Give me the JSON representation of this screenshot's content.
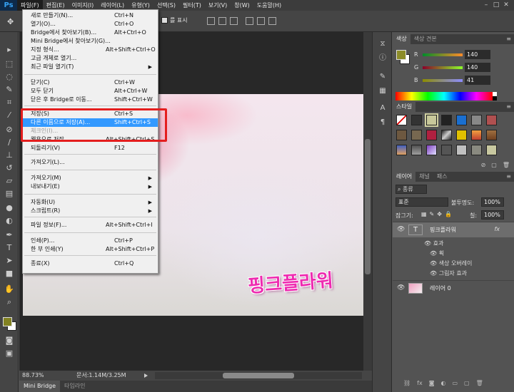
{
  "menubar": {
    "logo": "Ps",
    "items": [
      "파일(F)",
      "편집(E)",
      "이미지(I)",
      "레이어(L)",
      "유형(Y)",
      "선택(S)",
      "필터(T)",
      "보기(V)",
      "창(W)",
      "도움말(H)"
    ],
    "window_controls": [
      "–",
      "□",
      "✕"
    ]
  },
  "optionsbar": {
    "show_transform_label": "를 표시"
  },
  "file_menu": {
    "items": [
      {
        "label": "새로 만들기(N)...",
        "shortcut": "Ctrl+N"
      },
      {
        "label": "열기(O)...",
        "shortcut": "Ctrl+O"
      },
      {
        "label": "Bridge에서 찾아보기(B)...",
        "shortcut": "Alt+Ctrl+O"
      },
      {
        "label": "Mini Bridge에서 찾아보기(G)...",
        "shortcut": ""
      },
      {
        "label": "지정 형식...",
        "shortcut": "Alt+Shift+Ctrl+O"
      },
      {
        "label": "고급 개체로 열기...",
        "shortcut": ""
      },
      {
        "label": "최근 파일 열기(T)",
        "shortcut": ""
      },
      {
        "label": "닫기(C)",
        "shortcut": "Ctrl+W"
      },
      {
        "label": "모두 닫기",
        "shortcut": "Alt+Ctrl+W"
      },
      {
        "label": "닫은 후 Bridge로 이동...",
        "shortcut": "Shift+Ctrl+W"
      },
      {
        "label": "저장(S)",
        "shortcut": "Ctrl+S"
      },
      {
        "label": "다른 이름으로 저장(A)...",
        "shortcut": "Shift+Ctrl+S"
      },
      {
        "label": "체크인(I)...",
        "shortcut": ""
      },
      {
        "label": "웹용으로 저장...",
        "shortcut": "Alt+Shift+Ctrl+S"
      },
      {
        "label": "되돌리기(V)",
        "shortcut": "F12"
      },
      {
        "label": "가져오기(L)...",
        "shortcut": ""
      },
      {
        "label": "가져오기(M)",
        "shortcut": ""
      },
      {
        "label": "내보내기(E)",
        "shortcut": ""
      },
      {
        "label": "자동화(U)",
        "shortcut": ""
      },
      {
        "label": "스크립트(R)",
        "shortcut": ""
      },
      {
        "label": "파일 정보(F)...",
        "shortcut": "Alt+Shift+Ctrl+I"
      },
      {
        "label": "인쇄(P)...",
        "shortcut": "Ctrl+P"
      },
      {
        "label": "한 부 인쇄(Y)",
        "shortcut": "Alt+Shift+Ctrl+P"
      },
      {
        "label": "종료(X)",
        "shortcut": "Ctrl+Q"
      }
    ],
    "highlighted_label": "다른 이름으로 저장(A)...",
    "disabled_label": "체크인(I)..."
  },
  "canvas": {
    "text": "핑크플라워"
  },
  "statusbar": {
    "zoom": "88.73%",
    "doc_size": "문서:1.14M/3.25M"
  },
  "bottom_tabs": [
    "Mini Bridge",
    "타임라인"
  ],
  "color_panel": {
    "tabs": [
      "색상",
      "색상 견본"
    ],
    "fg_color": "#8c8c29",
    "channels": [
      {
        "label": "R",
        "value": "140"
      },
      {
        "label": "G",
        "value": "140"
      },
      {
        "label": "B",
        "value": "41"
      }
    ]
  },
  "styles_panel": {
    "tab": "스타일"
  },
  "layers_panel": {
    "tabs": [
      "레이어",
      "채널",
      "패스"
    ],
    "filter": "종류",
    "blend_mode": "표준",
    "opacity_label": "불투명도:",
    "opacity": "100%",
    "lock_label": "잠그기:",
    "fill_label": "칠:",
    "fill": "100%",
    "layers": [
      {
        "name": "핑크플라워",
        "type": "T",
        "fx": "fx"
      },
      {
        "name": "레이어 0",
        "type": "image"
      }
    ],
    "effects_label": "효과",
    "effects": [
      "획",
      "색상 오버레이",
      "그림자 효과"
    ]
  }
}
